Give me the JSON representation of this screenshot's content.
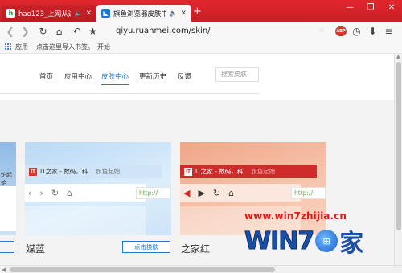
{
  "browser": {
    "tabs": [
      {
        "title": "hao123_上网从这里开",
        "active": false
      },
      {
        "title": "旗鱼浏览器皮肤中心",
        "active": true
      }
    ],
    "new_tab": "+",
    "window_controls": {
      "minimize": "—",
      "restore": "❐",
      "close": "✕"
    },
    "address_url": "qiyu.ruanmei.com/skin/",
    "abp_label": "ABP",
    "bookmarks": {
      "apps_label": "应用",
      "import_hint": "点击这里导入书签。",
      "start_label": "开始"
    },
    "accent_color": "#d8232a"
  },
  "site": {
    "nav": [
      "首页",
      "应用中心",
      "皮肤中心",
      "更新历史",
      "反馈"
    ],
    "active_nav": "皮肤中心",
    "search_placeholder": "搜索皮肤"
  },
  "skins": {
    "left_partial_text": "炉起始",
    "blue": {
      "name": "媒蓝",
      "apply_label": "点击换肤",
      "preview_tab_text": "IT之家 - 数码，科",
      "preview_tab_text2": "旗鱼起始",
      "preview_url": "http://",
      "logo_text": "IT"
    },
    "red": {
      "name": "之家红",
      "preview_tab_text": "IT之家 - 数码，科",
      "preview_tab_text2": "旗鱼起始",
      "preview_url": "http://",
      "logo_text": "IT"
    }
  },
  "watermark": {
    "url": "www.win7zhijia.cn",
    "logo_text": "WIN7",
    "logo_suffix": "家"
  }
}
